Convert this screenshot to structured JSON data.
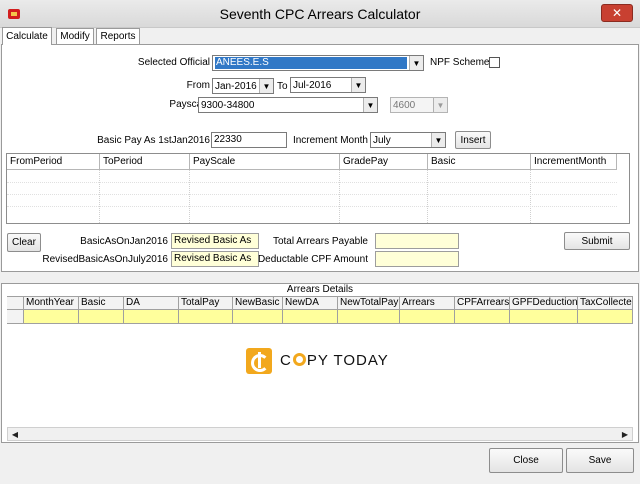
{
  "window": {
    "title": "Seventh CPC Arrears Calculator",
    "close_glyph": "✕"
  },
  "tabs": [
    {
      "label": "Calculate",
      "active": true
    },
    {
      "label": "Modify",
      "active": false
    },
    {
      "label": "Reports",
      "active": false
    }
  ],
  "form": {
    "selected_official_label": "Selected Official",
    "selected_official_value": "ANEES.E.S",
    "npf_label": "NPF Scheme",
    "npf_checked": false,
    "from_label": "From",
    "from_value": "Jan-2016",
    "to_label": "To",
    "to_value": "Jul-2016",
    "payscale_label": "Payscale",
    "payscale_value": "9300-34800",
    "grade_pay_value": "4600",
    "basic_pay_label": "Basic Pay As 1stJan2016",
    "basic_pay_value": "22330",
    "increment_month_label": "Increment Month",
    "increment_month_value": "July",
    "insert_label": "Insert"
  },
  "period_table": {
    "columns": [
      "FromPeriod",
      "ToPeriod",
      "PayScale",
      "GradePay",
      "Basic",
      "IncrementMonth"
    ],
    "rows": []
  },
  "summary": {
    "clear_label": "Clear",
    "basic_jan_label": "BasicAsOnJan2016",
    "basic_jan_value": "Revised Basic As",
    "revised_july_label": "RevisedBasicAsOnJuly2016",
    "revised_july_value": "Revised Basic As",
    "total_arrears_label": "Total Arrears Payable",
    "total_arrears_value": "",
    "deductable_cpf_label": "Deductable CPF Amount",
    "deductable_cpf_value": "",
    "submit_label": "Submit"
  },
  "arrears": {
    "title": "Arrears Details",
    "columns": [
      "MonthYear",
      "Basic",
      "DA",
      "TotalPay",
      "NewBasic",
      "NewDA",
      "NewTotalPay",
      "Arrears",
      "CPFArrears",
      "GPFDeduction",
      "TaxCollected"
    ],
    "rows": []
  },
  "watermark": {
    "brand_pre": "C",
    "brand_post": "PY TODAY"
  },
  "footer": {
    "close_label": "Close",
    "save_label": "Save"
  },
  "colors": {
    "selection": "#3178c6",
    "highlight_row": "#ffff9c",
    "readonly_field": "#ffffd8",
    "logo_accent": "#f2a81d"
  }
}
